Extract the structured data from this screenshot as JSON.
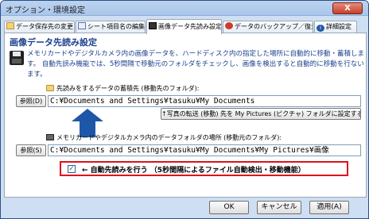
{
  "window": {
    "title": "オプション・環境設定",
    "close_label": "X"
  },
  "tabs": [
    {
      "label": "データ保存先の変更"
    },
    {
      "label": "シート項目名の編集"
    },
    {
      "label": "画像データ先読み設定"
    },
    {
      "label": "データのバックアップ／復元"
    },
    {
      "label": "詳細設定"
    }
  ],
  "section": {
    "title": "画像データ先読み設定",
    "description": "メモリカードやデジタルカメラ内の画像データを、ハードディスク内の指定した場所に自動的に移動・蓄積します。 自動先読み機能では、5秒間隔で移動元のフォルダをチェックし、画像を検出すると自動的に移動を行ないます。"
  },
  "destination": {
    "label": "先読みをするデータの蓄積先 (移動先のフォルダ):",
    "browse_label": "参照(D)",
    "path": "C:¥Documents and Settings¥tasuku¥My Documents",
    "set_pictures_label": "↑写真の転送 (移動) 先を My Pictures (ピクチャ) フォルダに設定する"
  },
  "source": {
    "label": "メモリカードやデジタルカメラ内のデータフォルダの場所 (移動元のフォルダ):",
    "browse_label": "参照(S)",
    "path": "C:¥Documents and Settings¥tasuku¥My Documents¥My Pictures¥画像"
  },
  "auto_prefetch": {
    "checked": true,
    "check_mark": "✓",
    "label": "← 自動先読みを行う （5秒間隔によるファイル自動検出・移動機能）"
  },
  "footer": {
    "ok_label": "OK",
    "cancel_label": "キャンセル",
    "apply_label": "適用(A)"
  },
  "colors": {
    "accent_text": "#1a3f8c",
    "arrow": "#1e57a8",
    "highlight_border": "#e0101a"
  }
}
